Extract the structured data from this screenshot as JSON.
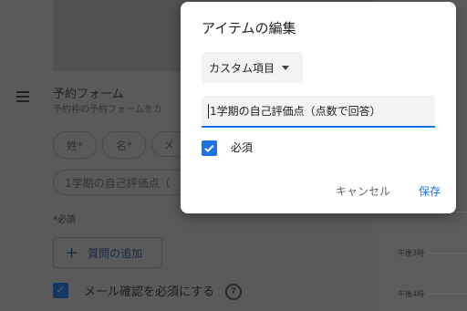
{
  "background": {
    "form_title": "予約フォーム",
    "form_subtitle": "予約枠の予約フォームをカ",
    "chips": [
      "姓*",
      "名*",
      "メ",
      "1学期の自己評価点（"
    ],
    "required_note": "*必須",
    "add_question_label": "質問の追加",
    "email_required_label": "メール確認を必須にする",
    "email_required_checked": true,
    "calendar_times": [
      "午後3時",
      "午後4時"
    ]
  },
  "dialog": {
    "title": "アイテムの編集",
    "type_dropdown": {
      "selected": "カスタム項目"
    },
    "question_field": {
      "value": "1学期の自己評価点（点数で回答）"
    },
    "required_checkbox": {
      "label": "必須",
      "checked": true
    },
    "cancel_label": "キャンセル",
    "save_label": "保存"
  },
  "colors": {
    "accent": "#1a73e8",
    "dialog_bg": "#ffffff",
    "field_bg": "#f1f3f4"
  }
}
